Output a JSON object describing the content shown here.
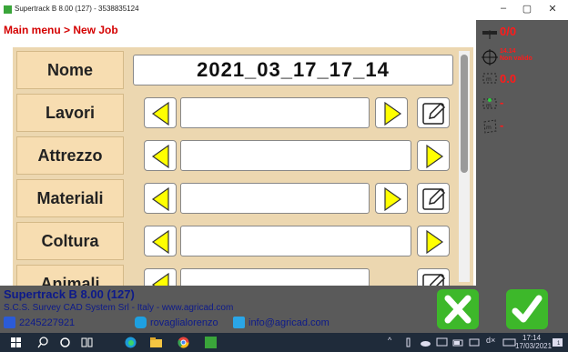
{
  "window": {
    "title": "Supertrack B 8.00 (127) - 3538835124",
    "minimize": "–",
    "maximize": "▢",
    "close": "✕"
  },
  "breadcrumb": "Main menu > New Job",
  "form": {
    "rows": [
      {
        "label": "Nome",
        "value": "2021_03_17_17_14"
      },
      {
        "label": "Lavori",
        "value": ""
      },
      {
        "label": "Attrezzo",
        "value": ""
      },
      {
        "label": "Materiali",
        "value": ""
      },
      {
        "label": "Coltura",
        "value": ""
      },
      {
        "label": "Animali",
        "value": ""
      }
    ]
  },
  "status_panel": {
    "satellites": "0/0",
    "accuracy": "14.14",
    "fix_status": "Non valido",
    "offset": "0.0",
    "distance1": "-",
    "distance2": "-"
  },
  "footer": {
    "product": "Supertrack B 8.00 (127)",
    "company": "S.C.S. Survey CAD System Srl - Italy - www.agricad.com",
    "phone": "2245227921",
    "skype": "rovaglialorenzo",
    "email": "info@agricad.com"
  },
  "taskbar": {
    "time": "17:14",
    "date": "17/03/2021",
    "notifications": "1"
  },
  "colors": {
    "accent_red": "#d40000",
    "panel_bg": "#ecd7b0",
    "arrow_yellow": "#ffff00",
    "confirm_green": "#3db82a"
  }
}
